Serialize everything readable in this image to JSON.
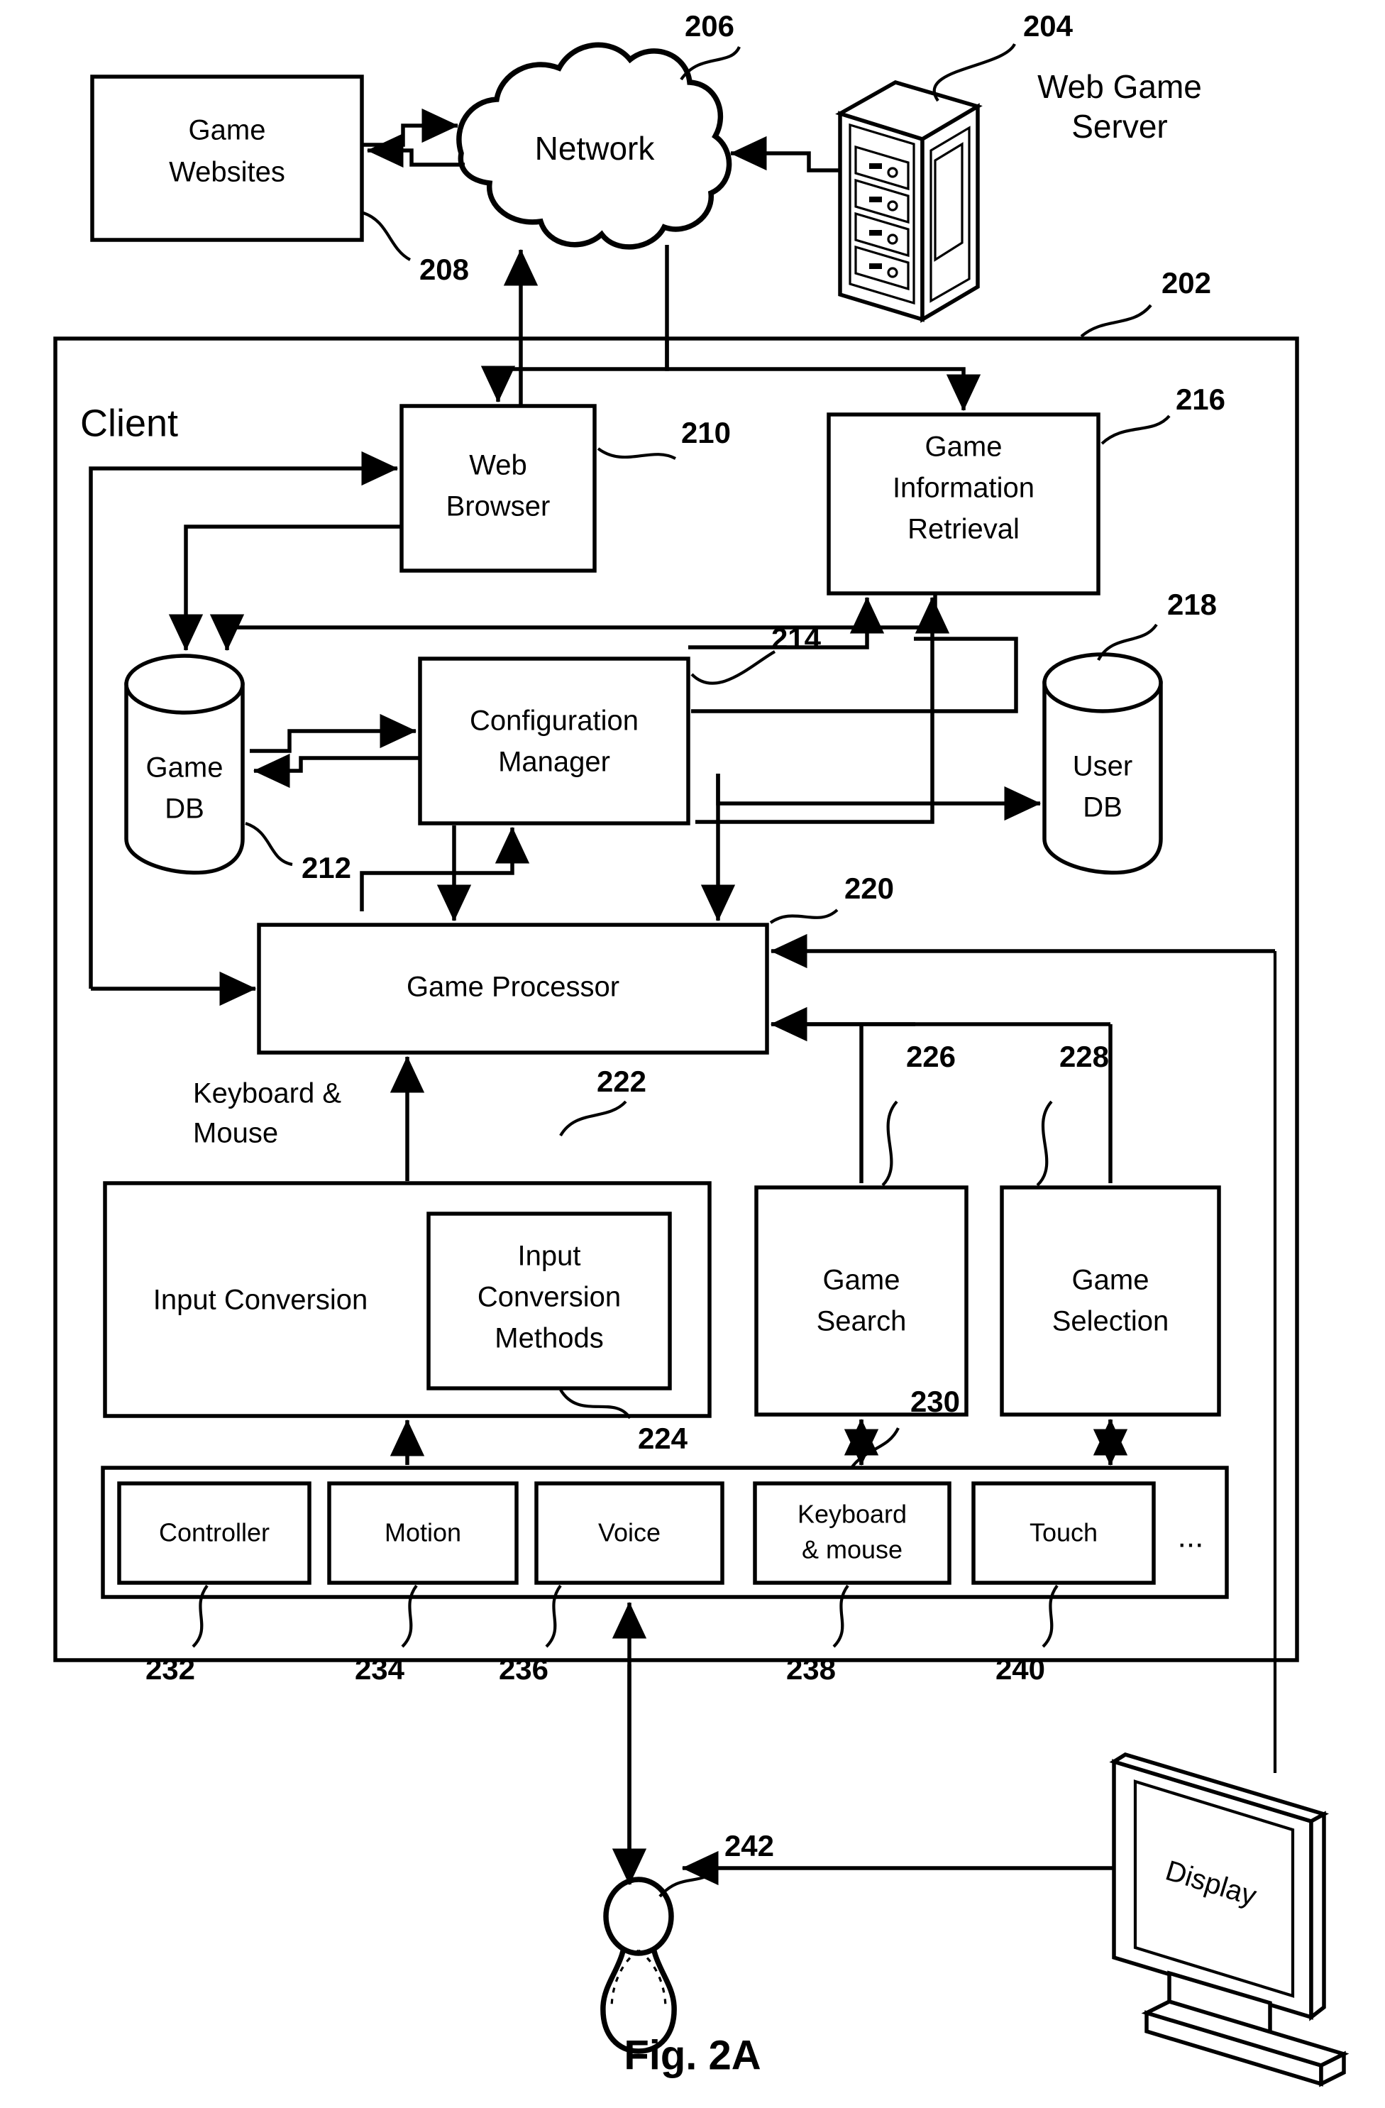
{
  "figure": {
    "caption": "Fig. 2A",
    "client_label": "Client"
  },
  "nodes": {
    "game_websites": {
      "label_line1": "Game",
      "label_line2": "Websites",
      "ref": "208"
    },
    "network": {
      "label": "Network",
      "ref": "206"
    },
    "web_game_server": {
      "label_line1": "Web Game",
      "label_line2": "Server",
      "ref": "204"
    },
    "client": {
      "label": "Client",
      "ref": "202"
    },
    "web_browser": {
      "label_line1": "Web",
      "label_line2": "Browser",
      "ref": "210"
    },
    "game_info_retrieval": {
      "label_line1": "Game",
      "label_line2": "Information",
      "label_line3": "Retrieval",
      "ref": "216"
    },
    "game_db": {
      "label_line1": "Game",
      "label_line2": "DB",
      "ref": "212"
    },
    "user_db": {
      "label_line1": "User",
      "label_line2": "DB",
      "ref": "218"
    },
    "configuration_manager": {
      "label_line1": "Configuration",
      "label_line2": "Manager",
      "ref": "214"
    },
    "game_processor": {
      "label": "Game Processor",
      "ref": "220"
    },
    "input_conversion": {
      "label": "Input Conversion",
      "ref": "222"
    },
    "input_conversion_methods": {
      "label_line1": "Input",
      "label_line2": "Conversion",
      "label_line3": "Methods",
      "ref": "224"
    },
    "game_search": {
      "label_line1": "Game",
      "label_line2": "Search",
      "ref": "226"
    },
    "game_selection": {
      "label_line1": "Game",
      "label_line2": "Selection",
      "ref": "228"
    },
    "input_devices_group": {
      "ref": "230"
    },
    "user": {
      "ref": "242"
    },
    "display": {
      "label": "Display"
    }
  },
  "edge_labels": {
    "keyboard_mouse": {
      "line1": "Keyboard &",
      "line2": "Mouse"
    }
  },
  "input_devices": [
    {
      "label": "Controller",
      "ref": "232"
    },
    {
      "label": "Motion",
      "ref": "234"
    },
    {
      "label": "Voice",
      "ref": "236"
    },
    {
      "label_line1": "Keyboard",
      "label_line2": "& mouse",
      "ref": "238"
    },
    {
      "label": "Touch",
      "ref": "240"
    },
    {
      "label": "..."
    }
  ],
  "colors": {
    "stroke": "#000000",
    "background": "#ffffff"
  }
}
